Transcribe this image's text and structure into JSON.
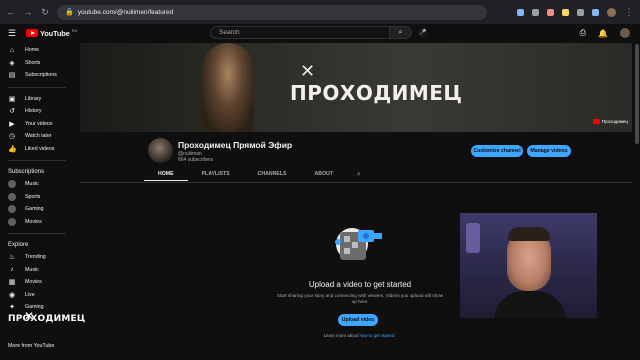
{
  "browser": {
    "url": "youtube.com/@nuliimen/featured"
  },
  "header": {
    "logo_text": "YouTube",
    "country_code": "RU",
    "search_placeholder": "Search"
  },
  "sidebar": {
    "main": [
      {
        "label": "Home",
        "icon": "home-icon",
        "glyph": "⌂"
      },
      {
        "label": "Shorts",
        "icon": "shorts-icon",
        "glyph": "◈"
      },
      {
        "label": "Subscriptions",
        "icon": "subscriptions-icon",
        "glyph": "▤"
      }
    ],
    "library": [
      {
        "label": "Library",
        "icon": "library-icon",
        "glyph": "▣"
      },
      {
        "label": "History",
        "icon": "history-icon",
        "glyph": "↺"
      },
      {
        "label": "Your videos",
        "icon": "your-videos-icon",
        "glyph": "▶"
      },
      {
        "label": "Watch later",
        "icon": "watch-later-icon",
        "glyph": "◷"
      },
      {
        "label": "Liked videos",
        "icon": "liked-videos-icon",
        "glyph": "👍"
      }
    ],
    "subscriptions_heading": "Subscriptions",
    "subscriptions": [
      {
        "label": "Music"
      },
      {
        "label": "Sports"
      },
      {
        "label": "Gaming"
      },
      {
        "label": "Movies"
      }
    ],
    "explore_heading": "Explore",
    "explore": [
      {
        "label": "Trending",
        "icon": "trending-icon",
        "glyph": "♨"
      },
      {
        "label": "Music",
        "icon": "music-icon",
        "glyph": "♪"
      },
      {
        "label": "Movies",
        "icon": "movies-icon",
        "glyph": "▦"
      },
      {
        "label": "Live",
        "icon": "live-icon",
        "glyph": "◉"
      },
      {
        "label": "Gaming",
        "icon": "gaming-icon",
        "glyph": "✦"
      }
    ],
    "bottom_hint": "More from YouTube"
  },
  "banner": {
    "brand_text": "ПРОХОДИМЕЦ",
    "corner_label": "Проходимец"
  },
  "channel": {
    "name": "Проходимец Прямой Эфир",
    "handle": "@nuliiman",
    "subscribers": "664 subscribers",
    "customize_label": "Customize channel",
    "manage_label": "Manage videos"
  },
  "tabs": [
    "HOME",
    "PLAYLISTS",
    "CHANNELS",
    "ABOUT"
  ],
  "empty_state": {
    "title": "Upload a video to get started",
    "subtitle": "Start sharing your story and connecting with viewers. Videos you upload will show up here.",
    "upload_label": "Upload video",
    "learn_prefix": "Learn more about ",
    "learn_link": "how to get started"
  },
  "watermark": {
    "text": "ПРОХОДИМЕЦ"
  },
  "colors": {
    "accent": "#3ea6ff",
    "background": "#0f0f0f",
    "youtube_red": "#ff0000"
  }
}
